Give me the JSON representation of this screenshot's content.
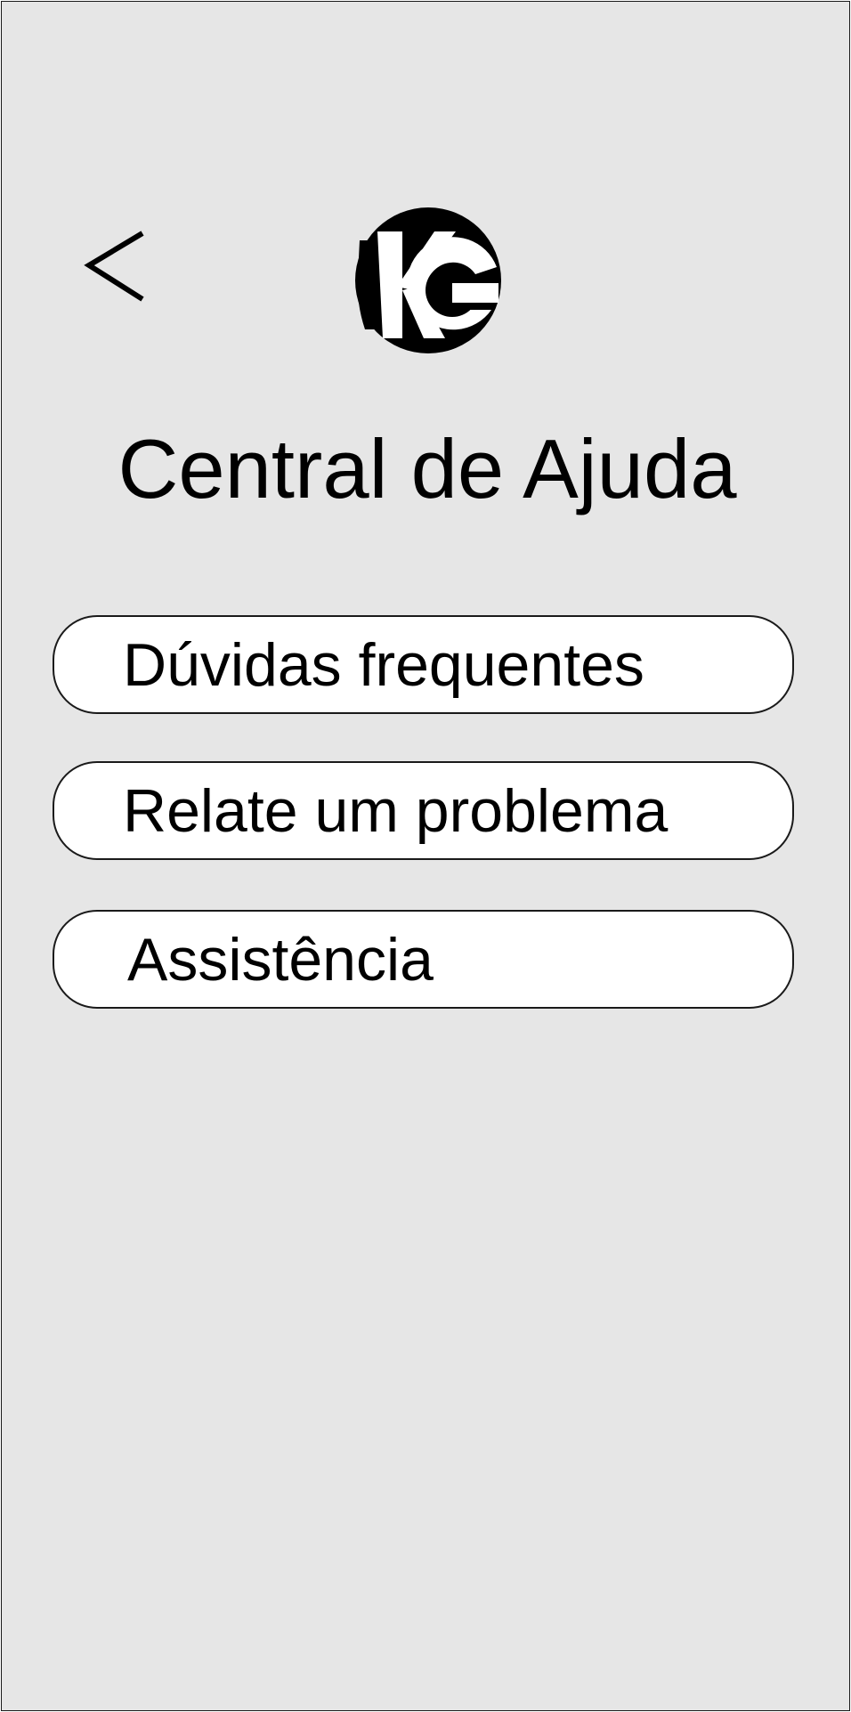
{
  "header": {
    "back_icon": "chevron-left-icon",
    "logo_text": "KG",
    "logo_color": "#000000"
  },
  "page": {
    "title": "Central de Ajuda"
  },
  "menu": {
    "items": [
      {
        "label": "Dúvidas frequentes"
      },
      {
        "label": "Relate um problema"
      },
      {
        "label": "Assistência"
      }
    ]
  },
  "colors": {
    "background": "#e6e6e6",
    "button_fill": "#ffffff",
    "border": "#1a1a1a",
    "text": "#000000"
  }
}
